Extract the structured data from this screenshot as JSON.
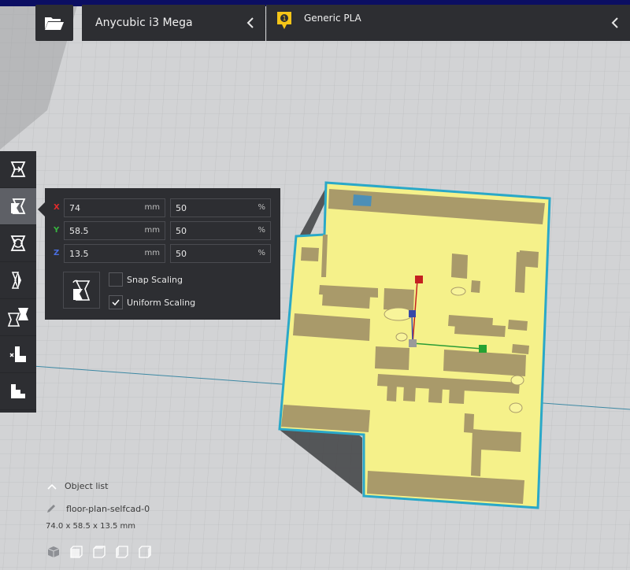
{
  "header": {
    "printer_name": "Anycubic i3 Mega",
    "material_name": "Generic PLA",
    "extruder_number": "1"
  },
  "toolbar": {
    "tools": [
      {
        "name": "move-tool",
        "icon": "move-icon"
      },
      {
        "name": "scale-tool",
        "icon": "scale-icon",
        "active": true
      },
      {
        "name": "rotate-tool",
        "icon": "rotate-icon"
      },
      {
        "name": "mirror-tool",
        "icon": "mirror-icon"
      },
      {
        "name": "per-model-settings-tool",
        "icon": "per-model-settings-icon"
      },
      {
        "name": "support-blocker-tool",
        "icon": "support-blocker-icon"
      },
      {
        "name": "layer-view-tool",
        "icon": "steps-icon"
      }
    ]
  },
  "scale_panel": {
    "x": {
      "label": "X",
      "mm": "74",
      "unit_mm": "mm",
      "percent": "50",
      "unit_pct": "%"
    },
    "y": {
      "label": "Y",
      "mm": "58.5",
      "unit_mm": "mm",
      "percent": "50",
      "unit_pct": "%"
    },
    "z": {
      "label": "Z",
      "mm": "13.5",
      "unit_mm": "mm",
      "percent": "50",
      "unit_pct": "%"
    },
    "snap_scaling": {
      "label": "Snap Scaling",
      "checked": false
    },
    "uniform_scaling": {
      "label": "Uniform Scaling",
      "checked": true
    }
  },
  "object_list": {
    "title": "Object list",
    "object_name": "floor-plan-selfcad-0",
    "dimensions": "74.0 x 58.5 x 13.5 mm"
  },
  "colors": {
    "panel": "#2d2e32",
    "accent_blue": "#0b0e62",
    "axis_x": "#e22b2b",
    "axis_y": "#37b53f",
    "axis_z": "#4a6ee0",
    "model": "#f5f18a",
    "outline": "#2aa8c8",
    "badge": "#f5c518"
  }
}
